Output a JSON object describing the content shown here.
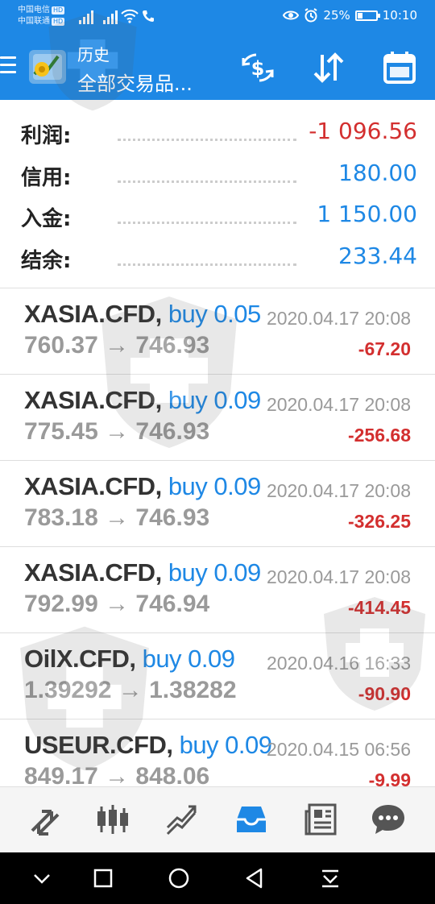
{
  "status_bar": {
    "carrier1": "中国电信",
    "carrier2": "中国联通",
    "hd_badge": "HD",
    "battery_percent": "25%",
    "battery_level": 0.25,
    "time": "10:10"
  },
  "app_bar": {
    "title": "历史",
    "subtitle": "全部交易品..."
  },
  "summary": [
    {
      "label": "利润:",
      "value": "-1 096.56",
      "tone": "neg"
    },
    {
      "label": "信用:",
      "value": "180.00",
      "tone": "pos"
    },
    {
      "label": "入金:",
      "value": "1 150.00",
      "tone": "pos"
    },
    {
      "label": "结余:",
      "value": "233.44",
      "tone": "pos"
    }
  ],
  "trades": [
    {
      "symbol": "XASIA.CFD,",
      "side": "buy 0.05",
      "time": "2020.04.17 20:08",
      "prices": "760.37 → 746.93",
      "profit": "-67.20"
    },
    {
      "symbol": "XASIA.CFD,",
      "side": "buy 0.09",
      "time": "2020.04.17 20:08",
      "prices": "775.45 → 746.93",
      "profit": "-256.68"
    },
    {
      "symbol": "XASIA.CFD,",
      "side": "buy 0.09",
      "time": "2020.04.17 20:08",
      "prices": "783.18 → 746.93",
      "profit": "-326.25"
    },
    {
      "symbol": "XASIA.CFD,",
      "side": "buy 0.09",
      "time": "2020.04.17 20:08",
      "prices": "792.99 → 746.94",
      "profit": "-414.45"
    },
    {
      "symbol": "OilX.CFD,",
      "side": "buy 0.09",
      "time": "2020.04.16 16:33",
      "prices": "1.39292 → 1.38282",
      "profit": "-90.90"
    },
    {
      "symbol": "USEUR.CFD,",
      "side": "buy 0.09",
      "time": "2020.04.15 06:56",
      "prices": "849.17 → 848.06",
      "profit": "-9.99"
    }
  ],
  "icons": {
    "appbar": [
      "currency-exchange-icon",
      "sort-icon",
      "calendar-icon"
    ],
    "bottom_nav": [
      "quotes-icon",
      "chart-icon",
      "trade-icon",
      "history-icon",
      "news-icon",
      "chat-icon"
    ],
    "system_nav": [
      "collapse-icon",
      "recents-icon",
      "home-icon",
      "back-icon",
      "notification-pull-icon"
    ]
  },
  "colors": {
    "primary": "#1e88e5",
    "negative": "#d32f2f",
    "active_nav": "#1e88e5",
    "inactive_nav": "#555555"
  }
}
